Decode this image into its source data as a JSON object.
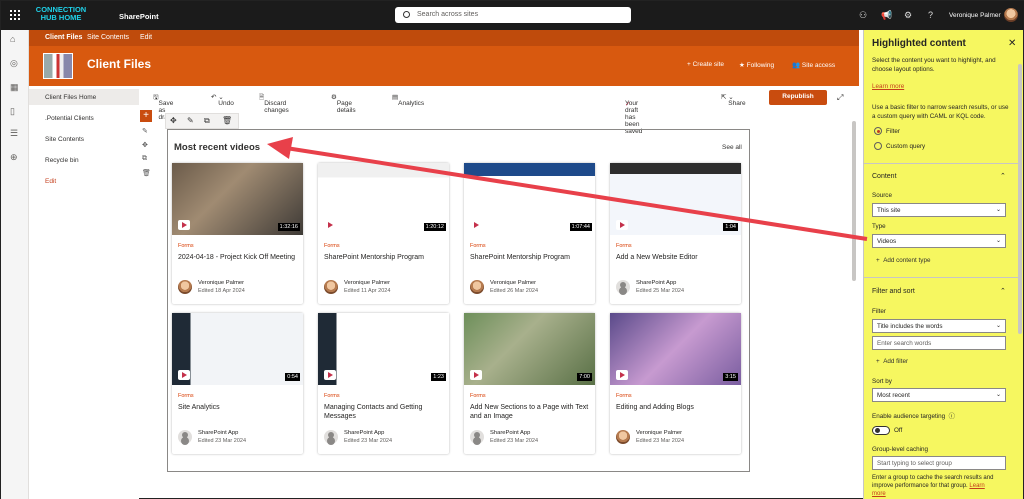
{
  "topbar": {
    "hub_title_line1": "CONNECTION",
    "hub_title_line2": "HUB HOME",
    "app_name": "SharePoint",
    "search_placeholder": "Search across sites",
    "user_name": "Veronique Palmer"
  },
  "hub_nav": {
    "items": [
      "Client Files",
      "Site Contents",
      "Edit"
    ]
  },
  "site": {
    "title": "Client Files",
    "actions": [
      "Create site",
      "Following",
      "Site access"
    ]
  },
  "site_nav": {
    "items": [
      "Client Files Home",
      ".Potential Clients",
      "Site Contents",
      "Recycle bin"
    ],
    "edit": "Edit"
  },
  "command_bar": {
    "save_as_draft": "Save as draft",
    "undo": "Undo",
    "discard": "Discard changes",
    "page_details": "Page details",
    "analytics": "Analytics",
    "draft_status": "Your draft has been saved",
    "share": "Share",
    "republish": "Republish"
  },
  "webpart": {
    "title": "Most recent videos",
    "see_all": "See all",
    "cards": [
      {
        "type": "Forms",
        "title": "2024-04-18 - Project Kick Off Meeting",
        "author": "Veronique Palmer",
        "date": "Edited 18 Apr 2024",
        "duration": "1:32:16",
        "avatar": "person"
      },
      {
        "type": "Forms",
        "title": "SharePoint Mentorship Program",
        "author": "Veronique Palmer",
        "date": "Edited 11 Apr 2024",
        "duration": "1:20:12",
        "avatar": "person"
      },
      {
        "type": "Forms",
        "title": "SharePoint Mentorship Program",
        "author": "Veronique Palmer",
        "date": "Edited 26 Mar 2024",
        "duration": "1:07:44",
        "avatar": "person"
      },
      {
        "type": "Forms",
        "title": "Add a New Website Editor",
        "author": "SharePoint App",
        "date": "Edited 25 Mar 2024",
        "duration": "1:04",
        "avatar": "app"
      },
      {
        "type": "Forms",
        "title": "Site Analytics",
        "author": "SharePoint App",
        "date": "Edited 23 Mar 2024",
        "duration": "0:54",
        "avatar": "app"
      },
      {
        "type": "Forms",
        "title": "Managing Contacts and Getting Messages",
        "author": "SharePoint App",
        "date": "Edited 23 Mar 2024",
        "duration": "1:23",
        "avatar": "app"
      },
      {
        "type": "Forms",
        "title": "Add New Sections to a Page with Text and an Image",
        "author": "SharePoint App",
        "date": "Edited 23 Mar 2024",
        "duration": "7:00",
        "avatar": "app"
      },
      {
        "type": "Forms",
        "title": "Editing and Adding Blogs",
        "author": "Veronique Palmer",
        "date": "Edited 23 Mar 2024",
        "duration": "3:15",
        "avatar": "person"
      }
    ]
  },
  "panel": {
    "title": "Highlighted content",
    "intro": "Select the content you want to highlight, and choose layout options.",
    "learn_more": "Learn more",
    "filter_intro": "Use a basic filter to narrow search results, or use a custom query with CAML or KQL code.",
    "radio_filter": "Filter",
    "radio_custom": "Custom query",
    "content_heading": "Content",
    "source_label": "Source",
    "source_value": "This site",
    "type_label": "Type",
    "type_value": "Videos",
    "add_content_type": "Add content type",
    "filter_sort_heading": "Filter and sort",
    "filter_label": "Filter",
    "filter_value": "Title includes the words",
    "search_words_placeholder": "Enter search words",
    "add_filter": "Add filter",
    "sort_label": "Sort by",
    "sort_value": "Most recent",
    "audience_label": "Enable audience targeting",
    "toggle_state": "Off",
    "group_caching_label": "Group-level caching",
    "group_placeholder": "Start typing to select group",
    "group_note": "Enter a group to cache the search results and improve performance for that group.",
    "group_note_link": "Learn",
    "group_note_tail": "more"
  },
  "colors": {
    "brand": "#d8590f",
    "hub_nav": "#bf4b0c",
    "panel_highlight": "#f6f760",
    "arrow": "#e8404a"
  }
}
